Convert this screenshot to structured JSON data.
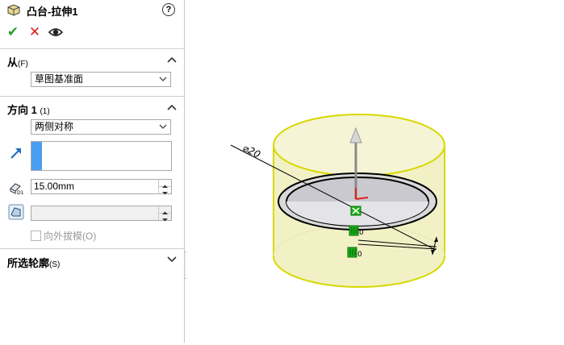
{
  "panel": {
    "title": "凸台-拉伸1",
    "help": "?",
    "actions": {
      "ok": "✔",
      "cancel": "✕",
      "preview": "👁"
    },
    "from": {
      "title": "从",
      "key": "(F)",
      "value": "草图基准面"
    },
    "direction1": {
      "title": "方向 1",
      "key": "(1)",
      "end_condition": "两侧对称",
      "depth": "15.00mm",
      "draft": "",
      "draft_outward_label": "向外拔模(O)"
    },
    "selected_contours": {
      "title": "所选轮廓",
      "key": "(S)"
    }
  },
  "viewport": {
    "dimension_label": "⌀20",
    "relation_tag_1": "0",
    "relation_tag_2": "0"
  },
  "colors": {
    "model_fill": "#f2f1c6",
    "model_edge": "#d8d800",
    "sketch_line": "#000000",
    "ok_green": "#2aa02a",
    "cancel_red": "#d81e1e",
    "accent_blue": "#4a9df0"
  }
}
